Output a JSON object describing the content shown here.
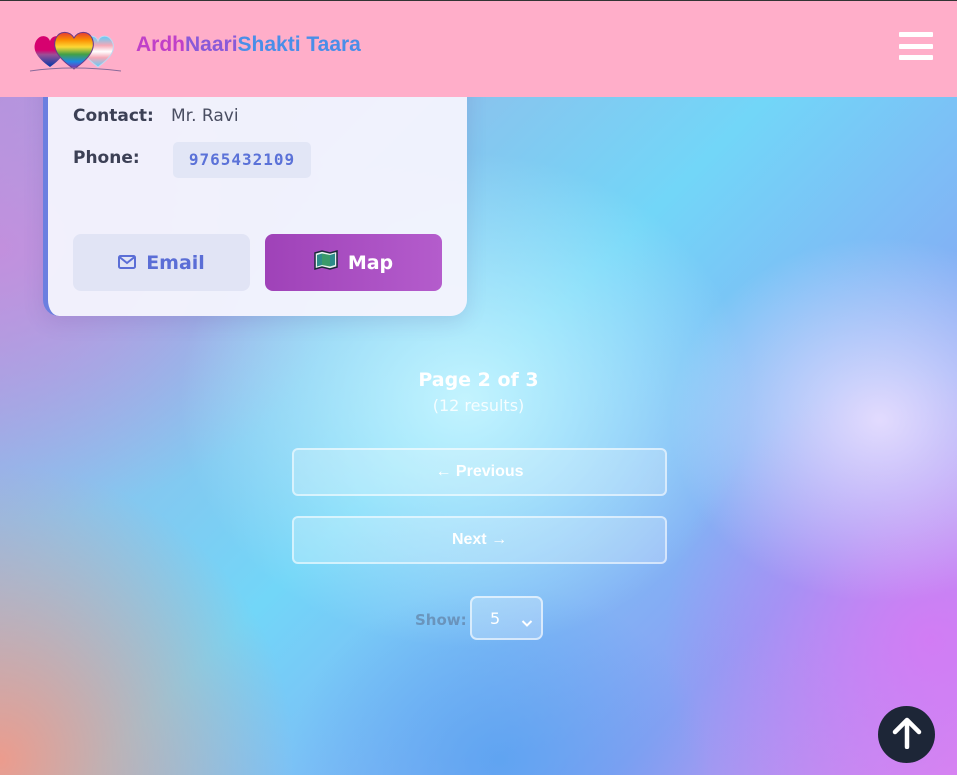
{
  "header": {
    "brand_part1": "Ardh",
    "brand_part2": "Naari",
    "brand_part3": "Shakti Taara",
    "logo_icon": "pride-hearts-logo",
    "menu_icon": "hamburger-menu-icon"
  },
  "card": {
    "contact_label": "Contact:",
    "contact_value": "Mr. Ravi",
    "phone_label": "Phone:",
    "phone_value": "9765432109",
    "email_button": "Email",
    "map_button": "Map"
  },
  "pagination": {
    "title": "Page 2 of 3",
    "subtitle": "(12 results)",
    "previous_label": "← Previous",
    "next_label": "Next →",
    "show_label": "Show:",
    "show_value": "5"
  },
  "colors": {
    "header_bg": "#ffaec9",
    "accent": "#6b7fe0",
    "map_button": "#a94cc1",
    "to_top_bg": "#1d2637"
  }
}
